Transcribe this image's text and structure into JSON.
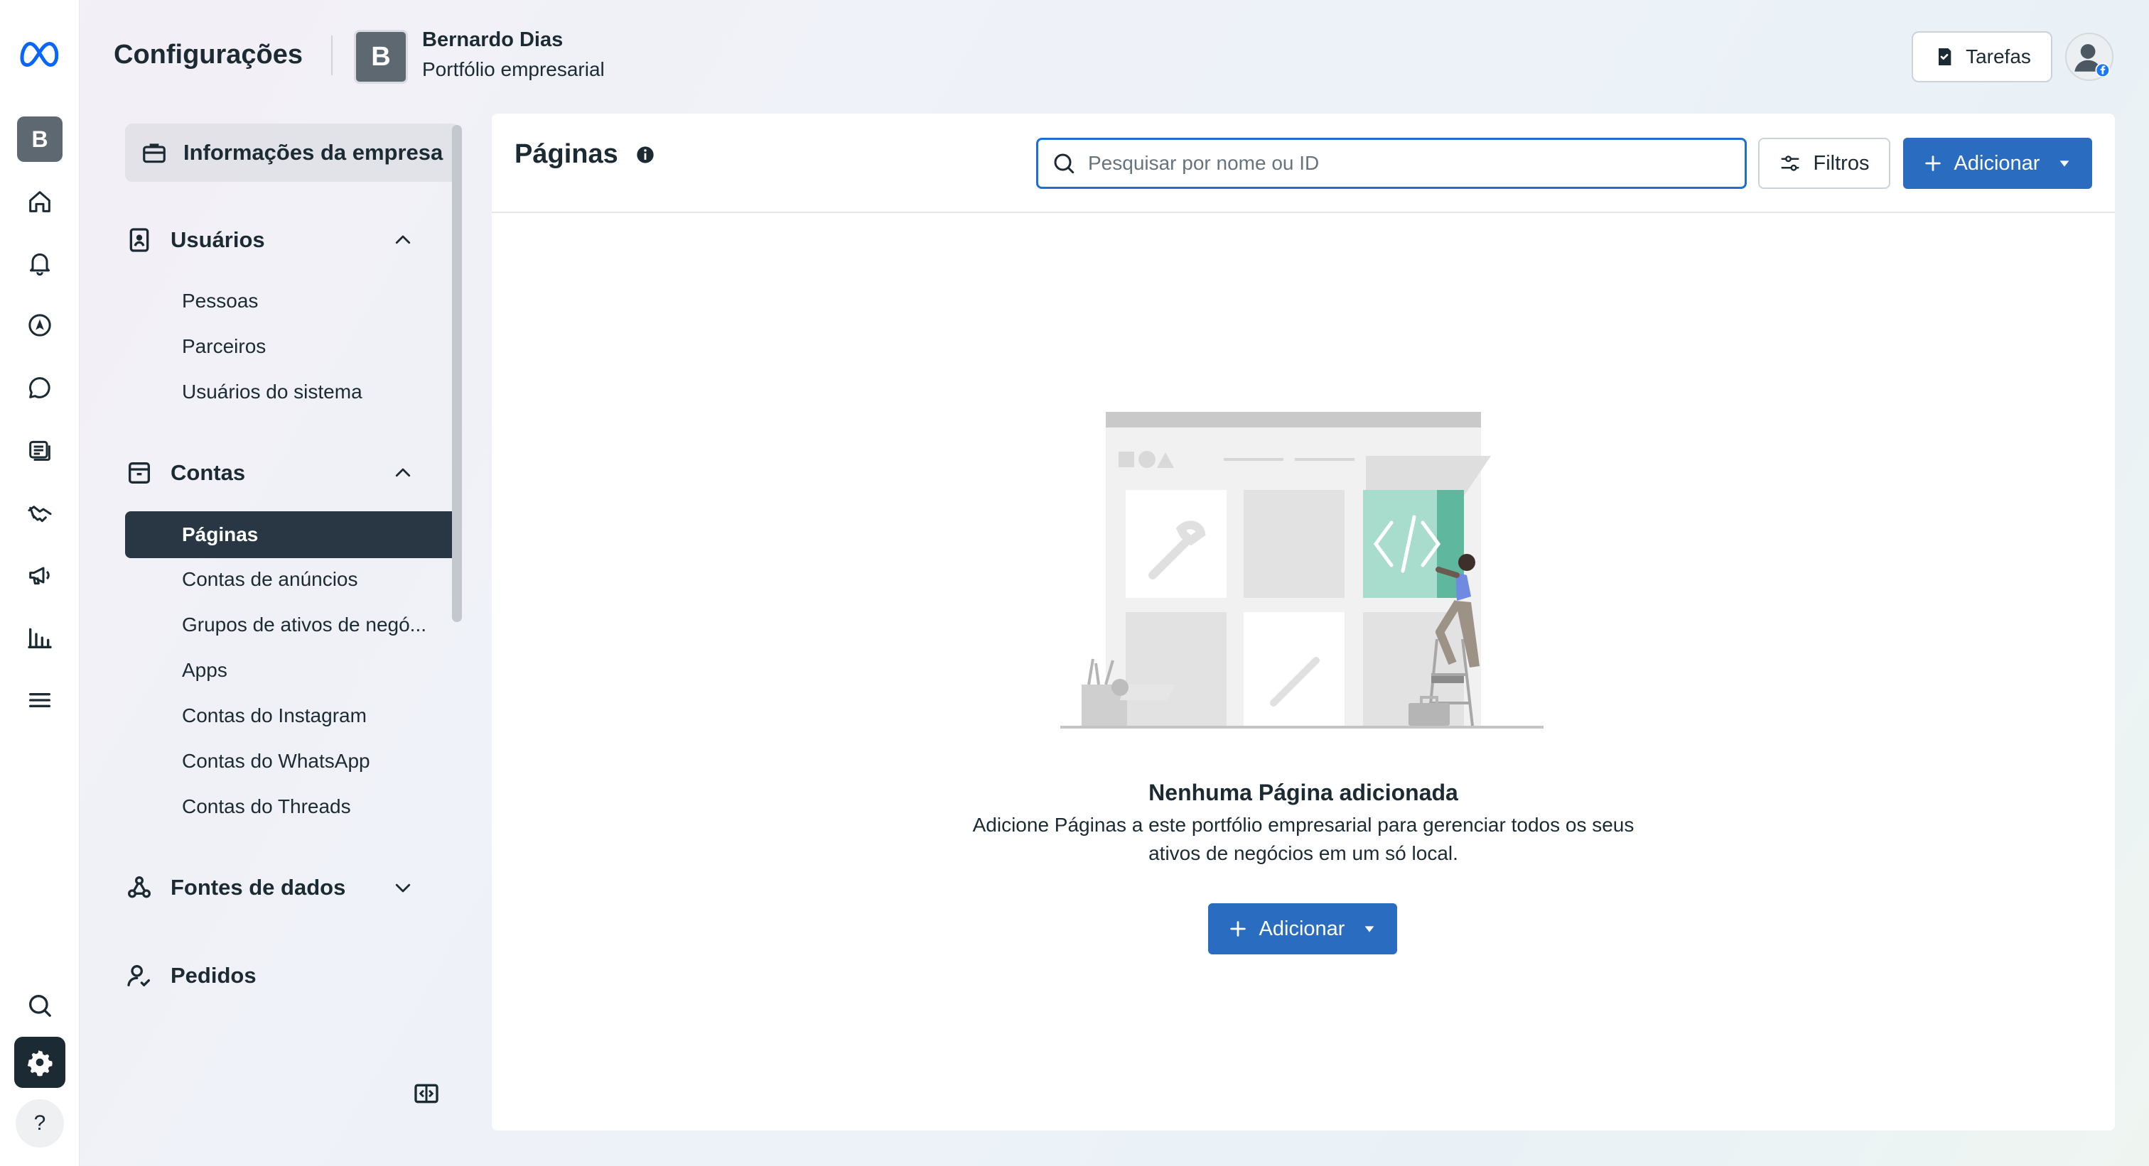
{
  "header": {
    "title": "Configurações",
    "business_avatar_letter": "B",
    "business_name": "Bernardo Dias",
    "business_subtitle": "Portfólio empresarial",
    "tasks_label": "Tarefas"
  },
  "rail": {
    "avatar_letter": "B",
    "help_label": "?",
    "icons": [
      "meta-logo-icon",
      "home-icon",
      "bell-icon",
      "compass-icon",
      "chat-bubble-icon",
      "content-icon",
      "handshake-icon",
      "megaphone-icon",
      "bar-chart-icon",
      "menu-icon",
      "search-icon",
      "gear-icon",
      "help-icon"
    ]
  },
  "sidebar": {
    "business_info": "Informações da empresa",
    "users": {
      "label": "Usuários",
      "items": [
        "Pessoas",
        "Parceiros",
        "Usuários do sistema"
      ]
    },
    "accounts": {
      "label": "Contas",
      "items": [
        "Páginas",
        "Contas de anúncios",
        "Grupos de ativos de negó...",
        "Apps",
        "Contas do Instagram",
        "Contas do WhatsApp",
        "Contas do Threads"
      ],
      "selected": "Páginas"
    },
    "data_sources": "Fontes de dados",
    "requests": "Pedidos"
  },
  "main": {
    "title": "Páginas",
    "search_placeholder": "Pesquisar por nome ou ID",
    "filters_label": "Filtros",
    "add_label": "Adicionar",
    "empty_title": "Nenhuma Página adicionada",
    "empty_desc_line1": "Adicione Páginas a este portfólio empresarial para gerenciar todos os seus",
    "empty_desc_line2": "ativos de negócios em um só local.",
    "empty_add_label": "Adicionar"
  },
  "colors": {
    "accent": "#2a6cc0",
    "selected_bg": "#283743",
    "search_border": "#1f6fd1"
  }
}
